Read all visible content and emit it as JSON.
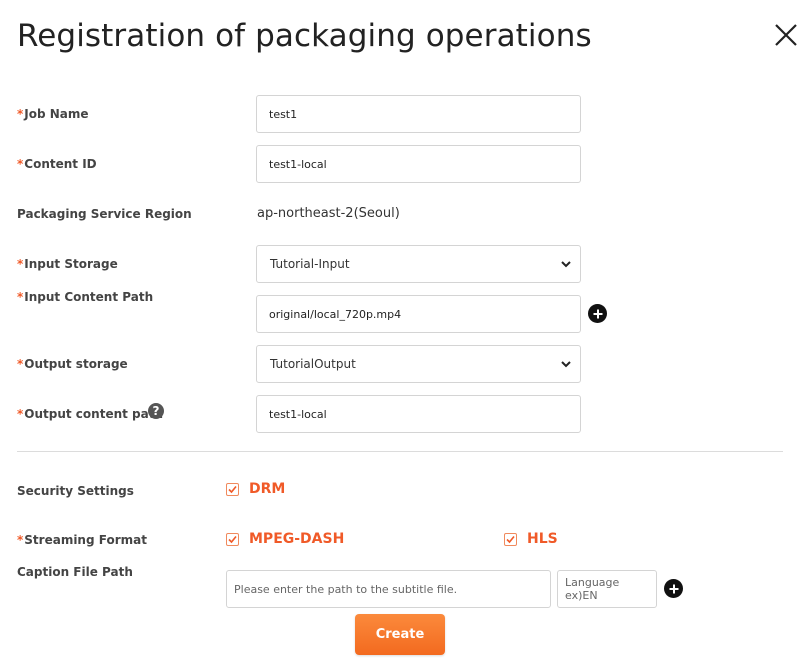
{
  "dialog": {
    "title": "Registration of packaging operations"
  },
  "form": {
    "required_mark": "*",
    "job_name": {
      "label": "Job Name",
      "value": "test1"
    },
    "content_id": {
      "label": "Content ID",
      "value": "test1-local"
    },
    "region": {
      "label": "Packaging Service Region",
      "value": "ap-northeast-2(Seoul)"
    },
    "input_storage": {
      "label": "Input Storage",
      "value": "Tutorial-Input"
    },
    "input_content_path": {
      "label": "Input Content Path",
      "value": "original/local_720p.mp4"
    },
    "output_storage": {
      "label": "Output storage",
      "value": "TutorialOutput"
    },
    "output_content_path": {
      "label": "Output content path",
      "value": "test1-local",
      "help": "?"
    },
    "security_settings": {
      "label": "Security Settings",
      "drm_label": "DRM",
      "drm_checked": true
    },
    "streaming_format": {
      "label": "Streaming Format",
      "options": [
        {
          "label": "MPEG-DASH",
          "checked": true
        },
        {
          "label": "HLS",
          "checked": true
        }
      ]
    },
    "caption_file_path": {
      "label": "Caption File Path",
      "path_placeholder": "Please enter the path to the subtitle file.",
      "language_placeholder": "Language ex)EN"
    }
  },
  "actions": {
    "create_label": "Create"
  },
  "colors": {
    "accent": "#f05a28",
    "button": "#f47a2c"
  },
  "icons": [
    "close-icon",
    "chevron-down-icon",
    "plus-icon",
    "help-icon",
    "checkmark-icon"
  ]
}
